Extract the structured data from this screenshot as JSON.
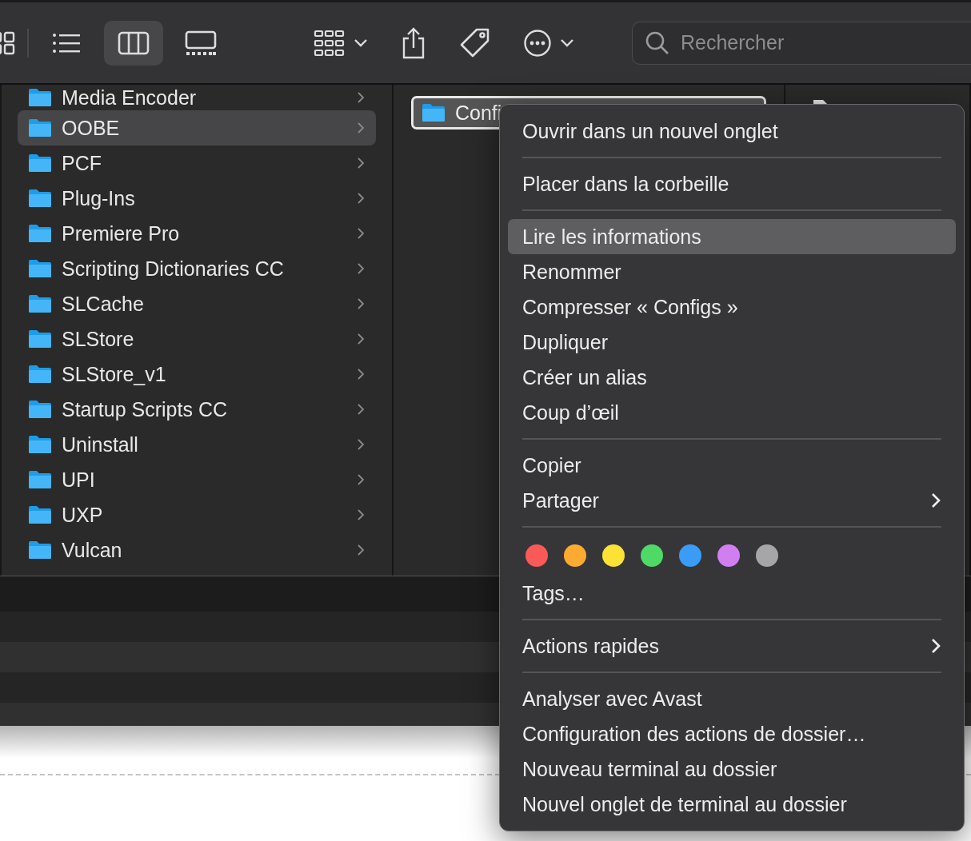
{
  "toolbar": {
    "view_buttons": [
      {
        "kind": "icons",
        "selected": false
      },
      {
        "kind": "list",
        "selected": false
      },
      {
        "kind": "columns",
        "selected": true
      },
      {
        "kind": "gallery",
        "selected": false
      }
    ],
    "search": {
      "placeholder": "Rechercher"
    }
  },
  "column_1": {
    "items": [
      {
        "name": "Media Encoder",
        "selected": false
      },
      {
        "name": "OOBE",
        "selected": true
      },
      {
        "name": "PCF",
        "selected": false
      },
      {
        "name": "Plug-Ins",
        "selected": false
      },
      {
        "name": "Premiere Pro",
        "selected": false
      },
      {
        "name": "Scripting Dictionaries CC",
        "selected": false
      },
      {
        "name": "SLCache",
        "selected": false
      },
      {
        "name": "SLStore",
        "selected": false
      },
      {
        "name": "SLStore_v1",
        "selected": false
      },
      {
        "name": "Startup Scripts CC",
        "selected": false
      },
      {
        "name": "Uninstall",
        "selected": false
      },
      {
        "name": "UPI",
        "selected": false
      },
      {
        "name": "UXP",
        "selected": false
      },
      {
        "name": "Vulcan",
        "selected": false
      }
    ]
  },
  "column_2": {
    "items": [
      {
        "name": "Confi",
        "selected": true
      }
    ]
  },
  "context_menu": {
    "groups": [
      {
        "items": [
          {
            "kind": "item",
            "label": "Ouvrir dans un nouvel onglet",
            "selected": false,
            "submenu": false
          }
        ]
      },
      {
        "items": [
          {
            "kind": "item",
            "label": "Placer dans la corbeille",
            "selected": false,
            "submenu": false
          }
        ]
      },
      {
        "items": [
          {
            "kind": "item",
            "label": "Lire les informations",
            "selected": true,
            "submenu": false
          },
          {
            "kind": "item",
            "label": "Renommer",
            "selected": false,
            "submenu": false
          },
          {
            "kind": "item",
            "label": "Compresser « Configs »",
            "selected": false,
            "submenu": false
          },
          {
            "kind": "item",
            "label": "Dupliquer",
            "selected": false,
            "submenu": false
          },
          {
            "kind": "item",
            "label": "Créer un alias",
            "selected": false,
            "submenu": false
          },
          {
            "kind": "item",
            "label": "Coup d’œil",
            "selected": false,
            "submenu": false
          }
        ]
      },
      {
        "items": [
          {
            "kind": "item",
            "label": "Copier",
            "selected": false,
            "submenu": false
          },
          {
            "kind": "item",
            "label": "Partager",
            "selected": false,
            "submenu": true
          }
        ]
      },
      {
        "items": [
          {
            "kind": "colors",
            "colors": [
              {
                "color": "#fa5a57"
              },
              {
                "color": "#fdaa31"
              },
              {
                "color": "#fce234"
              },
              {
                "color": "#4fd966"
              },
              {
                "color": "#3a9cf7"
              },
              {
                "color": "#d17ef0"
              },
              {
                "color": "#a6a6a8"
              }
            ]
          },
          {
            "kind": "item",
            "label": "Tags…",
            "selected": false,
            "submenu": false
          }
        ]
      },
      {
        "items": [
          {
            "kind": "item",
            "label": "Actions rapides",
            "selected": false,
            "submenu": true
          }
        ]
      },
      {
        "items": [
          {
            "kind": "item",
            "label": "Analyser avec Avast",
            "selected": false,
            "submenu": false
          },
          {
            "kind": "item",
            "label": "Configuration des actions de dossier…",
            "selected": false,
            "submenu": false
          },
          {
            "kind": "item",
            "label": "Nouveau terminal au dossier",
            "selected": false,
            "submenu": false
          },
          {
            "kind": "item",
            "label": "Nouvel onglet de terminal au dossier",
            "selected": false,
            "submenu": false
          }
        ]
      }
    ]
  }
}
